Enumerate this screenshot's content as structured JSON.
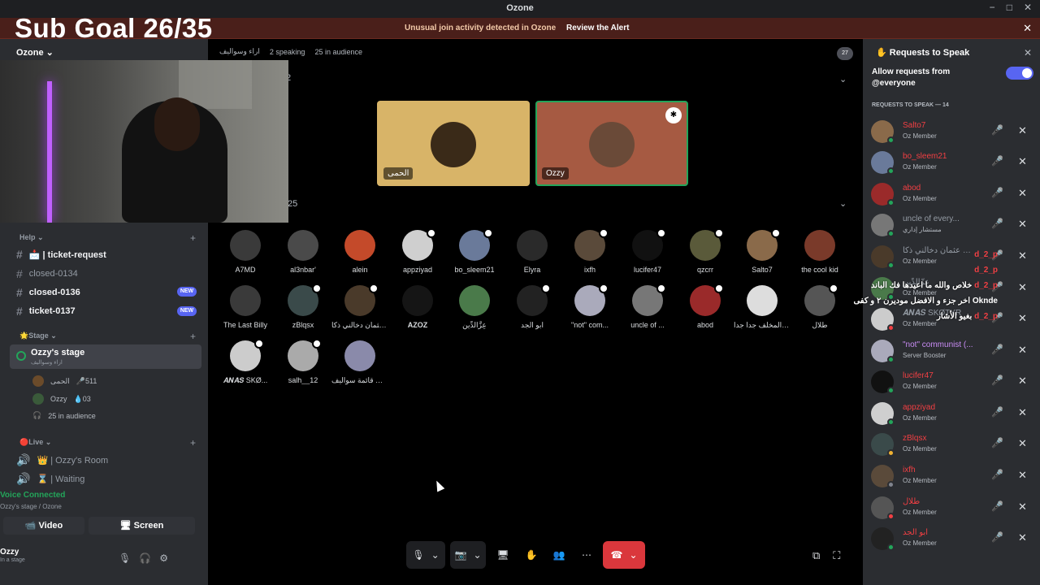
{
  "window": {
    "title": "Ozone",
    "controls": [
      "−",
      "□",
      "✕"
    ]
  },
  "alert": {
    "message": "Unusual join activity detected in Ozone",
    "action": "Review the Alert",
    "close": "✕"
  },
  "overlay": {
    "sub_goal": "Sub Goal 26/35"
  },
  "server": {
    "name": "Ozone ⌄"
  },
  "sidebar": {
    "help_category": "Help ⌄",
    "channels": [
      {
        "label": "📩 | ticket-request",
        "active": true
      },
      {
        "label": "closed-0134",
        "active": false
      },
      {
        "label": "closed-0136",
        "active": true,
        "badge": "NEW"
      },
      {
        "label": "ticket-0137",
        "active": true,
        "badge": "NEW"
      }
    ],
    "stage_category": "🌟Stage ⌄",
    "stage": {
      "name": "Ozzy's stage",
      "sub": "اراء وسواليف"
    },
    "stage_members": [
      {
        "name": "الحمى",
        "extra": "🎤511"
      },
      {
        "name": "Ozzy",
        "extra": "💧03"
      }
    ],
    "audience_label": "25 in audience",
    "live_category": "🔴Live ⌄",
    "live_channels": [
      "👑 | Ozzy's Room",
      "⌛ | Waiting"
    ]
  },
  "voice": {
    "status": "Voice Connected",
    "location": "Ozzy's stage / Ozone",
    "video_label": "Video",
    "screen_label": "Screen"
  },
  "user": {
    "name": "Ozzy",
    "status": "In a stage"
  },
  "main": {
    "stage_topic": "اراء وسواليف",
    "speaking": "2 speaking",
    "audience_count": "25 in audience",
    "notif": "27",
    "speakers_count": "2",
    "audience_header_count": "25",
    "speakers": [
      {
        "name": "الحمى",
        "bg": "#d8b468",
        "color": "#3a2a18"
      },
      {
        "name": "Ozzy",
        "bg": "#a65a42",
        "color": "#6a4a38"
      }
    ],
    "audience": [
      "A7MD",
      "al3nbar'",
      "alein",
      "appziyad",
      "bo_sleem21",
      "Elyra",
      "ixfh",
      "lucifer47",
      "qzcrr",
      "Salto7",
      "the cool kid",
      "The Last Billy",
      "zBlqsx",
      "عثمان دخالني ذكا ...",
      "AZOZ",
      "عِزَّالدِّين",
      "ابو الجد",
      "\"not\" com...",
      "uncle of ...",
      "abod",
      "ون المخلف جدا جدا ...",
      "طلال",
      "𝑨𝑵𝑨𝑺 SKØ...",
      "salh__12",
      "ت قائمة سواليف ..."
    ]
  },
  "controls": {
    "leave": "☎"
  },
  "requests": {
    "title": "Requests to Speak",
    "allow_label": "Allow requests from @everyone",
    "header": "REQUESTS TO SPEAK — 14",
    "items": [
      {
        "name": "Salto7",
        "role": "Oz Member"
      },
      {
        "name": "bo_sleem21",
        "role": "Oz Member"
      },
      {
        "name": "abod",
        "role": "Oz Member"
      },
      {
        "name": "uncle of every...",
        "role": "مستشار إداري"
      },
      {
        "name": "عثمان دخالني ذكا OZZY",
        "role": "Oz Member"
      },
      {
        "name": "عِزَّالدِّين",
        "role": "Oz Member"
      },
      {
        "name": "𝑨𝑵𝑨𝑺 SKØTYR",
        "role": "Oz Member"
      },
      {
        "name": "\"not\" communist (...",
        "role": "Server Booster"
      },
      {
        "name": "lucifer47",
        "role": "Oz Member"
      },
      {
        "name": "appziyad",
        "role": "Oz Member"
      },
      {
        "name": "zBlqsx",
        "role": "Oz Member"
      },
      {
        "name": "ixfh",
        "role": "Oz Member"
      },
      {
        "name": "طلال",
        "role": "Oz Member"
      },
      {
        "name": "ابو الجد",
        "role": "Oz Member"
      }
    ]
  },
  "chat_overlay": [
    {
      "user": "d_2_p",
      "msg": ""
    },
    {
      "user": "d_2_p",
      "msg": ""
    },
    {
      "user": "d_2_p",
      "msg": "خلاص والله ما اعيدها فك الباند"
    },
    {
      "user": "Oknde",
      "msg": "اخر جزء و الافضل موديرن ٢ و كفى"
    },
    {
      "user": "d_2_p",
      "msg": "بغيو الأشار"
    }
  ]
}
